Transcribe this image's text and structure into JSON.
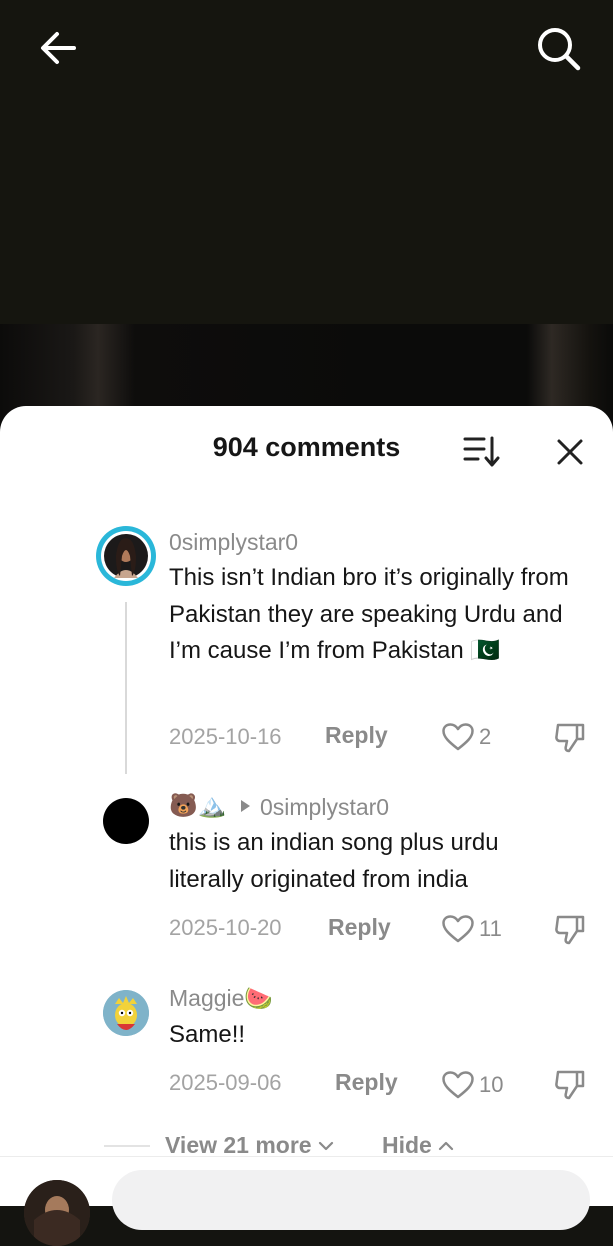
{
  "header": {
    "back_icon": "arrow-left-icon",
    "search_icon": "search-icon"
  },
  "sheet": {
    "title": "904 comments",
    "sort_icon": "sort-icon",
    "close_icon": "close-icon"
  },
  "comments": [
    {
      "username": "0simplystar0",
      "text": "This isn’t Indian bro it’s originally from Pakistan they are speaking Urdu and I’m cause I’m from Pakistan 🇵🇰",
      "date": "2025-10-16",
      "reply_label": "Reply",
      "likes": "2"
    },
    {
      "username": "🐻🏔️",
      "reply_to": "0simplystar0",
      "text": "this is an indian song plus urdu literally originated from india",
      "date": "2025-10-20",
      "reply_label": "Reply",
      "likes": "11"
    },
    {
      "username": "Maggie🍉",
      "text": "Same!!",
      "date": "2025-09-06",
      "reply_label": "Reply",
      "likes": "10"
    }
  ],
  "thread_controls": {
    "view_more": "View 21 more",
    "hide": "Hide"
  },
  "colors": {
    "story_ring": "#2ab7d9",
    "text_primary": "#161616",
    "text_secondary": "#8a8a8a"
  }
}
